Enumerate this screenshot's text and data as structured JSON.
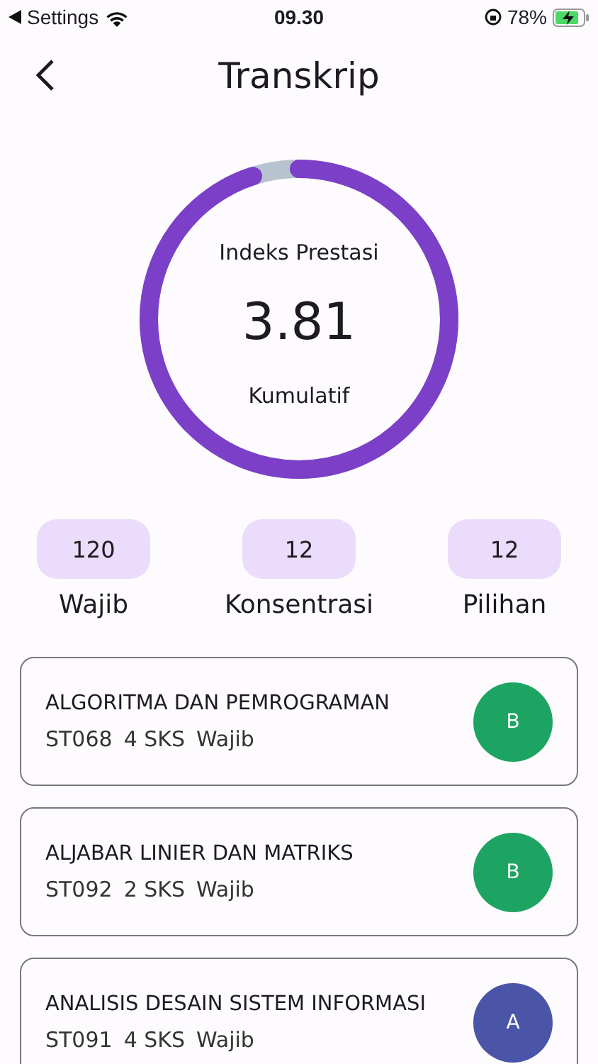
{
  "status_bar": {
    "back_label": "Settings",
    "time": "09.30",
    "battery": "78%"
  },
  "header": {
    "title": "Transkrip"
  },
  "gpa": {
    "label": "Indeks Prestasi",
    "value": "3.81",
    "caption": "Kumulatif",
    "level": 0.95
  },
  "credits": [
    {
      "value": "120",
      "label": "Wajib"
    },
    {
      "value": "12",
      "label": "Konsentrasi"
    },
    {
      "value": "12",
      "label": "Pilihan"
    }
  ],
  "courses": [
    {
      "name": "ALGORITMA DAN PEMROGRAMAN",
      "code": "ST068",
      "sks": "4 SKS",
      "type": "Wajib",
      "grade": "B",
      "color": "#1ea462"
    },
    {
      "name": "ALJABAR LINIER DAN MATRIKS",
      "code": "ST092",
      "sks": "2 SKS",
      "type": "Wajib",
      "grade": "B",
      "color": "#1ea462"
    },
    {
      "name": "ANALISIS DESAIN SISTEM INFORMASI",
      "code": "ST091",
      "sks": "4 SKS",
      "type": "Wajib",
      "grade": "A",
      "color": "#4b55a8"
    }
  ]
}
